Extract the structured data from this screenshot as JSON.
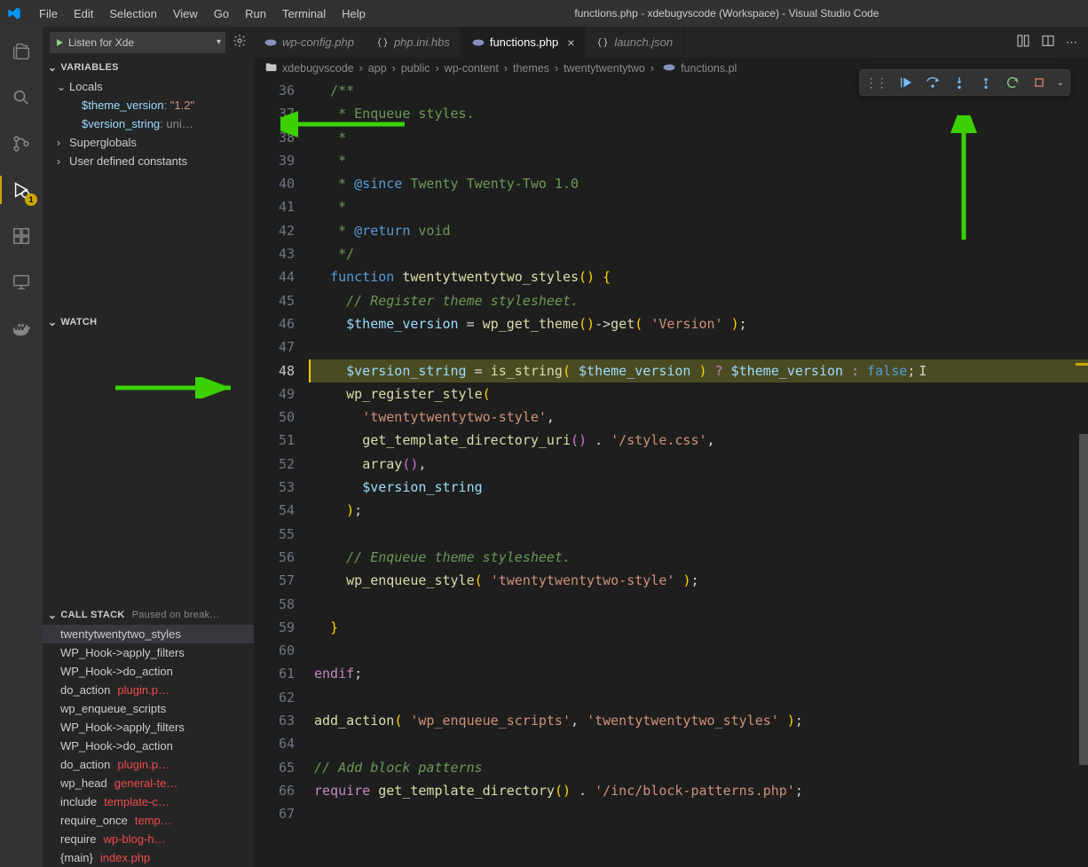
{
  "title": "functions.php - xdebugvscode (Workspace) - Visual Studio Code",
  "menubar": [
    "File",
    "Edit",
    "Selection",
    "View",
    "Go",
    "Run",
    "Terminal",
    "Help"
  ],
  "debug": {
    "config_label": "Listen for Xde",
    "badge": "1"
  },
  "sections": {
    "variables": "VARIABLES",
    "watch": "WATCH",
    "callstack": "CALL STACK",
    "callstack_status": "Paused on break…"
  },
  "variables": {
    "scopes": [
      {
        "name": "Locals",
        "expanded": true,
        "items": [
          {
            "name": "$theme_version",
            "value": "\"1.2\"",
            "type": "str"
          },
          {
            "name": "$version_string",
            "value": "uni…",
            "type": "dim"
          }
        ]
      },
      {
        "name": "Superglobals",
        "expanded": false
      },
      {
        "name": "User defined constants",
        "expanded": false
      }
    ]
  },
  "callstack": [
    {
      "fn": "twentytwentytwo_styles",
      "file": "",
      "active": true
    },
    {
      "fn": "WP_Hook->apply_filters",
      "file": ""
    },
    {
      "fn": "WP_Hook->do_action",
      "file": ""
    },
    {
      "fn": "do_action",
      "file": "plugin.p…"
    },
    {
      "fn": "wp_enqueue_scripts",
      "file": ""
    },
    {
      "fn": "WP_Hook->apply_filters",
      "file": ""
    },
    {
      "fn": "WP_Hook->do_action",
      "file": ""
    },
    {
      "fn": "do_action",
      "file": "plugin.p…"
    },
    {
      "fn": "wp_head",
      "file": "general-te…"
    },
    {
      "fn": "include",
      "file": "template-c…"
    },
    {
      "fn": "require_once",
      "file": "temp…"
    },
    {
      "fn": "require",
      "file": "wp-blog-h…"
    },
    {
      "fn": "{main}",
      "file": "index.php"
    }
  ],
  "tabs": [
    {
      "label": "wp-config.php",
      "icon": "php",
      "italic": true
    },
    {
      "label": "php.ini.hbs",
      "icon": "json",
      "italic": true
    },
    {
      "label": "functions.php",
      "icon": "php",
      "active": true,
      "close": true
    },
    {
      "label": "launch.json",
      "icon": "json",
      "italic": true
    }
  ],
  "breadcrumbs": [
    "xdebugvscode",
    "app",
    "public",
    "wp-content",
    "themes",
    "twentytwentytwo",
    "functions.pl"
  ],
  "gutter_start": 36,
  "current_line": 48,
  "code_lines": [
    {
      "n": 36,
      "html": "  <span class='c-doc'>/**</span>"
    },
    {
      "n": 37,
      "html": "  <span class='c-doc'> * Enqueue styles.</span>"
    },
    {
      "n": 38,
      "html": "  <span class='c-doc'> *</span>"
    },
    {
      "n": 39,
      "html": "  <span class='c-doc'> *</span>"
    },
    {
      "n": 40,
      "html": "  <span class='c-doc'> * <span class='c-kw'>@since</span> Twenty Twenty-Two 1.0</span>"
    },
    {
      "n": 41,
      "html": "  <span class='c-doc'> *</span>"
    },
    {
      "n": 42,
      "html": "  <span class='c-doc'> * <span class='c-kw'>@return</span> void</span>"
    },
    {
      "n": 43,
      "html": "  <span class='c-doc'> */</span>"
    },
    {
      "n": 44,
      "html": "  <span class='c-kw'>function</span> <span class='c-fnname'>twentytwentytwo_styles</span><span class='c-par'>()</span> <span class='c-par'>{</span>"
    },
    {
      "n": 45,
      "html": "    <span class='c-com'>// Register theme stylesheet.</span>"
    },
    {
      "n": 46,
      "html": "    <span class='c-var'>$theme_version</span> <span class='c-def'>=</span> <span class='c-fnname'>wp_get_theme</span><span class='c-par'>()</span><span class='c-def'>-></span><span class='c-fnname'>get</span><span class='c-par'>(</span> <span class='c-str'>'Version'</span> <span class='c-par'>)</span><span class='c-def'>;</span>"
    },
    {
      "n": 47,
      "html": ""
    },
    {
      "n": 48,
      "hl": true,
      "html": "    <span class='c-var'>$version_string</span> <span class='c-def'>=</span> <span class='c-fnname'>is_string</span><span class='c-par'>(</span> <span class='c-var'>$theme_version</span> <span class='c-par'>)</span> <span class='c-pnk'>?</span> <span class='c-var'>$theme_version</span> <span class='c-pnk'>:</span> <span class='c-kw'>false</span><span class='c-def'>;</span>"
    },
    {
      "n": 49,
      "html": "    <span class='c-fnname'>wp_register_style</span><span class='c-par'>(</span>"
    },
    {
      "n": 50,
      "html": "      <span class='c-str'>'twentytwentytwo-style'</span><span class='c-def'>,</span>"
    },
    {
      "n": 51,
      "html": "      <span class='c-fnname'>get_template_directory_uri</span><span class='c-par2'>()</span> <span class='c-def'>.</span> <span class='c-str'>'/style.css'</span><span class='c-def'>,</span>"
    },
    {
      "n": 52,
      "html": "      <span class='c-fnname'>array</span><span class='c-par2'>()</span><span class='c-def'>,</span>"
    },
    {
      "n": 53,
      "html": "      <span class='c-var'>$version_string</span>"
    },
    {
      "n": 54,
      "html": "    <span class='c-par'>)</span><span class='c-def'>;</span>"
    },
    {
      "n": 55,
      "html": ""
    },
    {
      "n": 56,
      "html": "    <span class='c-com'>// Enqueue theme stylesheet.</span>"
    },
    {
      "n": 57,
      "html": "    <span class='c-fnname'>wp_enqueue_style</span><span class='c-par'>(</span> <span class='c-str'>'twentytwentytwo-style'</span> <span class='c-par'>)</span><span class='c-def'>;</span>"
    },
    {
      "n": 58,
      "html": ""
    },
    {
      "n": 59,
      "html": "  <span class='c-par'>}</span>"
    },
    {
      "n": 60,
      "html": ""
    },
    {
      "n": 61,
      "html": "<span class='c-pnk'>endif</span><span class='c-def'>;</span>"
    },
    {
      "n": 62,
      "html": ""
    },
    {
      "n": 63,
      "html": "<span class='c-fnname'>add_action</span><span class='c-par'>(</span> <span class='c-str'>'wp_enqueue_scripts'</span><span class='c-def'>,</span> <span class='c-str'>'twentytwentytwo_styles'</span> <span class='c-par'>)</span><span class='c-def'>;</span>"
    },
    {
      "n": 64,
      "html": ""
    },
    {
      "n": 65,
      "html": "<span class='c-com'>// Add block patterns</span>"
    },
    {
      "n": 66,
      "html": "<span class='c-pnk'>require</span> <span class='c-fnname'>get_template_directory</span><span class='c-par'>()</span> <span class='c-def'>.</span> <span class='c-str'>'/inc/block-patterns.php'</span><span class='c-def'>;</span>"
    },
    {
      "n": 67,
      "html": ""
    }
  ]
}
